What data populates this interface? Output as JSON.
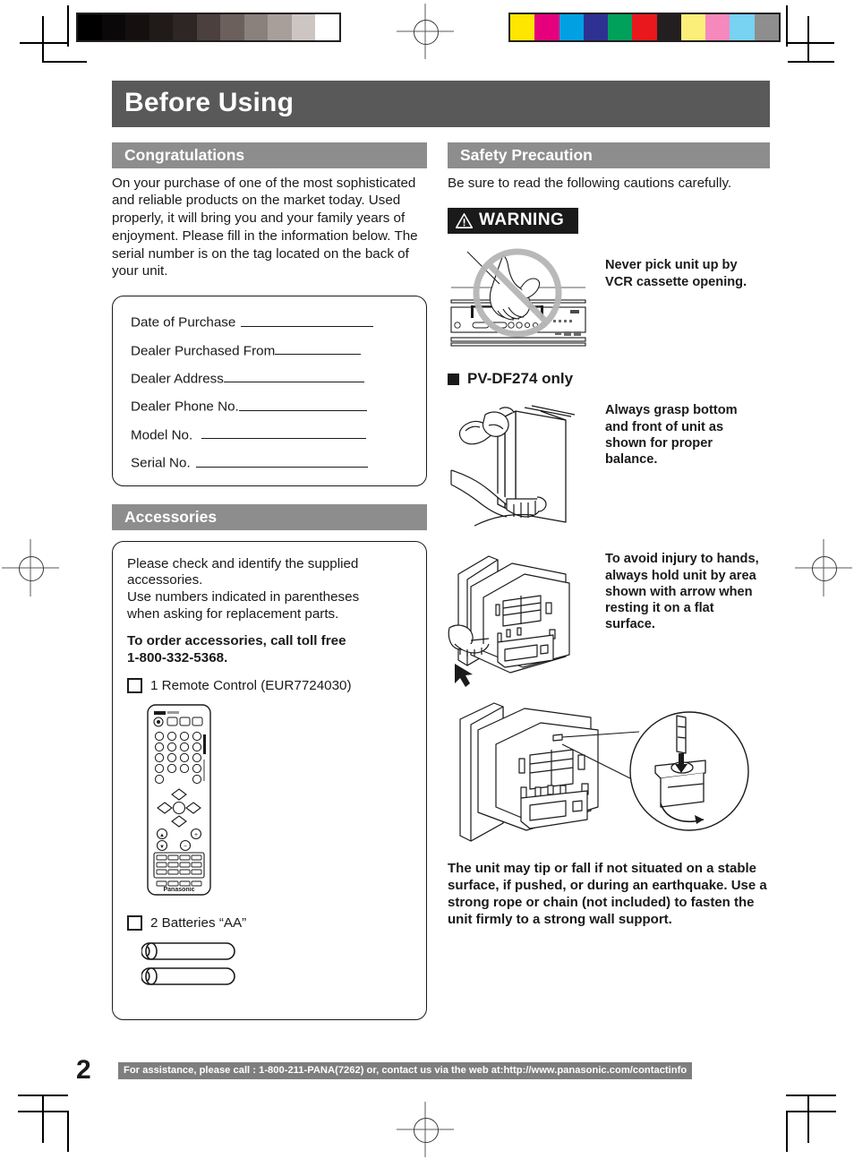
{
  "document": {
    "title": "Before Using",
    "page_number": "2"
  },
  "print_marks": {
    "gray_wedge": [
      "#000000",
      "#0b0809",
      "#15100f",
      "#201a18",
      "#2e2624",
      "#4b403d",
      "#6b605c",
      "#8a817d",
      "#a89f9b",
      "#cdc5c1",
      "#ffffff"
    ],
    "color_bars": [
      "#fee600",
      "#e6007e",
      "#00a0e3",
      "#2e3192",
      "#00a15a",
      "#e8181c",
      "#231f20",
      "#fbef7a",
      "#f589bd",
      "#78d2f2",
      "#8e8e8e"
    ]
  },
  "left_column": {
    "congratulations": {
      "heading": "Congratulations",
      "body": "On your purchase of one of the most sophisticated and reliable products on the market today. Used properly, it will bring you and your family years of enjoyment. Please fill in the information below. The serial number is on the tag located on the back of your unit.",
      "fields": [
        {
          "label": "Date of Purchase",
          "rule_width": 148,
          "gap": 6
        },
        {
          "label": "Dealer Purchased From",
          "rule_width": 96,
          "gap": 0
        },
        {
          "label": "Dealer Address",
          "rule_width": 157,
          "gap": 0
        },
        {
          "label": "Dealer Phone No.",
          "rule_width": 143,
          "gap": 0
        },
        {
          "label": "Model No.",
          "rule_width": 184,
          "gap": 10
        },
        {
          "label": "Serial No.",
          "rule_width": 192,
          "gap": 6
        }
      ]
    },
    "accessories": {
      "heading": "Accessories",
      "intro_line1": "Please check and identify the supplied",
      "intro_line2": "accessories.",
      "intro_line3": "Use numbers indicated in parentheses",
      "intro_line4": "when asking for replacement parts.",
      "order_line1": "To order accessories, call toll free",
      "order_line2": "1-800-332-5368.",
      "items": [
        {
          "label": "1 Remote Control (EUR7724030)",
          "figure": "remote-control"
        },
        {
          "label": "2 Batteries “AA”",
          "figure": "aa-batteries"
        }
      ],
      "remote_brand": "Panasonic"
    }
  },
  "right_column": {
    "safety": {
      "heading": "Safety Precaution",
      "body": "Be sure to read the following cautions carefully.",
      "warning_label": "WARNING",
      "cautions": [
        {
          "figure": "no-lift-by-cassette-opening-icon",
          "text": "Never pick unit up by VCR cassette opening."
        },
        {
          "figure": "grasp-bottom-and-front-icon",
          "text": "Always grasp bottom and front of unit as shown for proper balance."
        },
        {
          "figure": "hold-unit-by-arrow-area-icon",
          "text": "To avoid injury to hands, always hold unit by area shown with arrow when resting it on a flat surface."
        }
      ],
      "model_note": "PV-DF274 only",
      "tip_warning": "The unit may tip or fall if not situated on a stable surface, if pushed, or during an earthquake. Use a strong rope or chain (not included) to fasten the unit firmly to a strong wall support."
    }
  },
  "footer": {
    "assistance": "For assistance, please call : 1-800-211-PANA(7262) or, contact us via the web at:http://www.panasonic.com/contactinfo"
  }
}
